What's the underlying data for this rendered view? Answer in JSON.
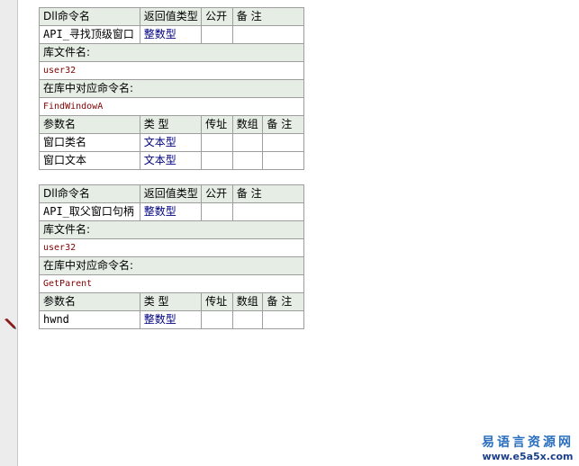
{
  "dll_tables": [
    {
      "headers": [
        "Dll命令名",
        "返回值类型",
        "公开",
        "备 注"
      ],
      "command_name": "API_寻找顶级窗口",
      "return_type": "整数型",
      "lib_label": "库文件名:",
      "lib_value": "user32",
      "entry_label": "在库中对应命令名:",
      "entry_value": "FindWindowA",
      "param_headers": [
        "参数名",
        "类 型",
        "传址",
        "数组",
        "备 注"
      ],
      "params": [
        {
          "name": "窗口类名",
          "type": "文本型"
        },
        {
          "name": "窗口文本",
          "type": "文本型"
        }
      ]
    },
    {
      "headers": [
        "Dll命令名",
        "返回值类型",
        "公开",
        "备 注"
      ],
      "command_name": "API_取父窗口句柄",
      "return_type": "整数型",
      "lib_label": "库文件名:",
      "lib_value": "user32",
      "entry_label": "在库中对应命令名:",
      "entry_value": "GetParent",
      "param_headers": [
        "参数名",
        "类 型",
        "传址",
        "数组",
        "备 注"
      ],
      "params": [
        {
          "name": "hwnd",
          "type": "整数型"
        }
      ]
    }
  ],
  "watermark": {
    "title": "易语言资源网",
    "url": "www.e5a5x.com"
  },
  "colors": {
    "header_bg": "#e5ede5",
    "type_text": "#000080",
    "value_text": "#800000",
    "border": "#9d9d9d"
  }
}
